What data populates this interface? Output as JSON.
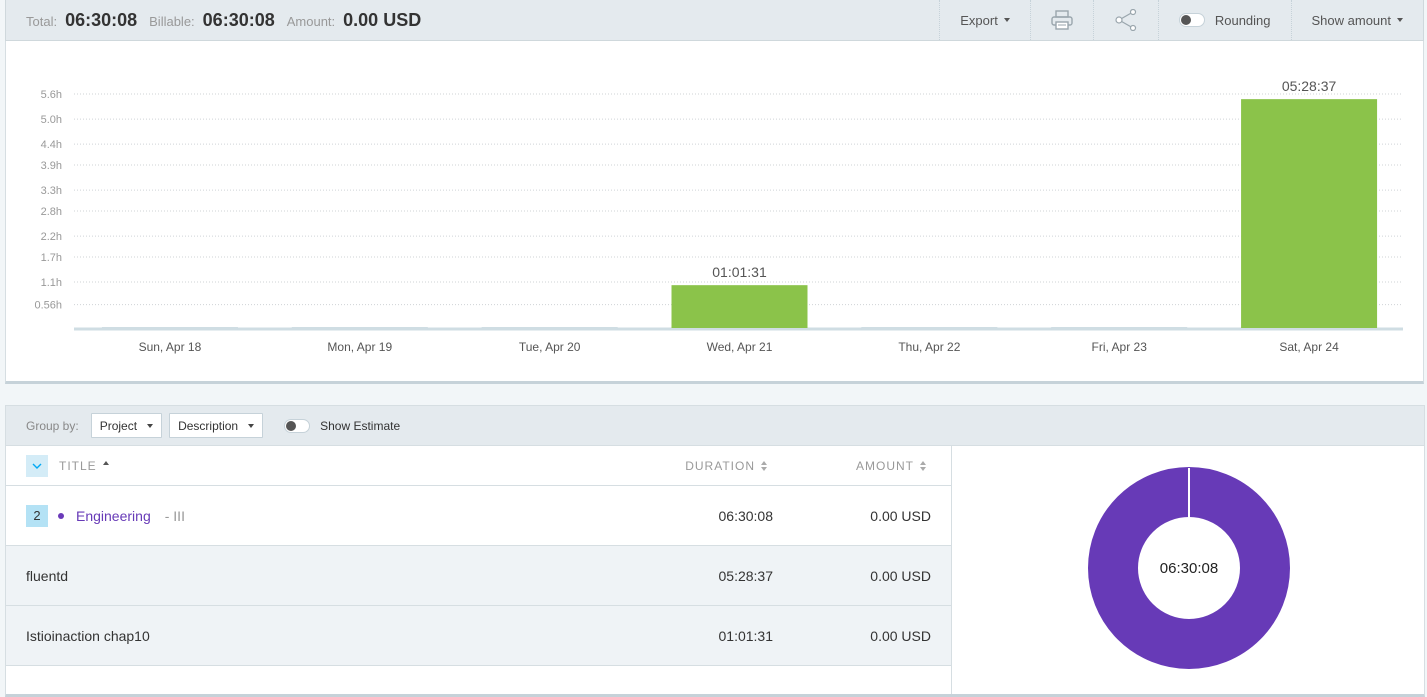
{
  "summary": {
    "total_label": "Total:",
    "total_value": "06:30:08",
    "billable_label": "Billable:",
    "billable_value": "06:30:08",
    "amount_label": "Amount:",
    "amount_value": "0.00 USD"
  },
  "toolbar": {
    "export_label": "Export",
    "print_icon": "printer-icon",
    "share_icon": "share-icon",
    "rounding_label": "Rounding",
    "rounding_on": false,
    "show_amount_label": "Show amount"
  },
  "colors": {
    "bar": "#8bc34a",
    "empty_bar": "#cfdde3",
    "project": "#673ab7"
  },
  "chart_data": {
    "type": "bar",
    "categories": [
      "Sun, Apr 18",
      "Mon, Apr 19",
      "Tue, Apr 20",
      "Wed, Apr 21",
      "Thu, Apr 22",
      "Fri, Apr 23",
      "Sat, Apr 24"
    ],
    "values": [
      0,
      0,
      0,
      1.025,
      0,
      0,
      5.477
    ],
    "data_labels": [
      "",
      "",
      "",
      "01:01:31",
      "",
      "",
      "05:28:37"
    ],
    "y_ticks": [
      0.56,
      1.1,
      1.7,
      2.2,
      2.8,
      3.3,
      3.9,
      4.4,
      5.0,
      5.6
    ],
    "y_tick_labels": [
      "0.56h",
      "1.1h",
      "1.7h",
      "2.2h",
      "2.8h",
      "3.3h",
      "3.9h",
      "4.4h",
      "5.0h",
      "5.6h"
    ],
    "ylim": [
      0,
      5.6
    ],
    "grid": true,
    "unit": "hours"
  },
  "group_by": {
    "label": "Group by:",
    "first": "Project",
    "second": "Description",
    "show_estimate_label": "Show Estimate",
    "show_estimate_on": false
  },
  "table": {
    "headers": {
      "title": "TITLE",
      "duration": "DURATION",
      "amount": "AMOUNT"
    },
    "project_row": {
      "count": "2",
      "project": "Engineering",
      "client": "- III",
      "duration": "06:30:08",
      "amount": "0.00 USD"
    },
    "rows": [
      {
        "title": "fluentd",
        "duration": "05:28:37",
        "amount": "0.00 USD"
      },
      {
        "title": "Istioinaction chap10",
        "duration": "01:01:31",
        "amount": "0.00 USD"
      }
    ]
  },
  "donut": {
    "center_label": "06:30:08",
    "slices": [
      {
        "label": "Engineering",
        "fraction": 1.0
      }
    ]
  }
}
